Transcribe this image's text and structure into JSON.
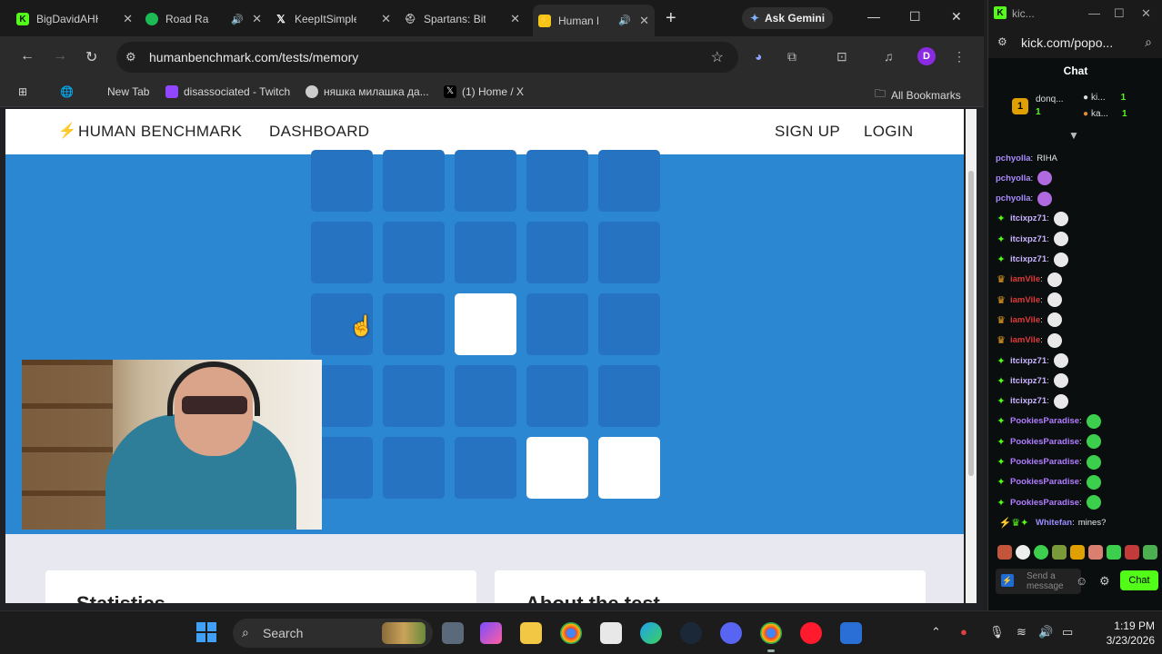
{
  "browser": {
    "tabs": [
      {
        "label": "BigDavidAHH",
        "icon": "kick-icon",
        "color": "#53fc18",
        "sound": false
      },
      {
        "label": "Road Ra",
        "icon": "spotify-icon",
        "color": "#1db954",
        "sound": true
      },
      {
        "label": "KeepItSimple",
        "icon": "x-icon",
        "color": "#ffffff",
        "sound": false
      },
      {
        "label": "Spartans: Bit",
        "icon": "spartan-icon",
        "color": "#cccccc",
        "sound": false
      },
      {
        "label": "Human B",
        "icon": "bolt-icon",
        "color": "#f5c518",
        "sound": true
      }
    ],
    "new_tab_glyph": "+",
    "gemini_label": "Ask Gemini",
    "url": "humanbenchmark.com/tests/memory",
    "profile_initial": "D",
    "bookmarks": [
      {
        "label": "New Tab",
        "color": ""
      },
      {
        "label": "disassociated - Twitch",
        "color": "#9146ff"
      },
      {
        "label": "няшка милашка да...",
        "color": "#cccccc"
      },
      {
        "label": "(1) Home / X",
        "color": "#000000"
      }
    ],
    "all_bookmarks": "All Bookmarks"
  },
  "site": {
    "brand": "HUMAN BENCHMARK",
    "dashboard": "DASHBOARD",
    "signup": "SIGN UP",
    "login": "LOGIN",
    "grid": {
      "rows": 5,
      "cols": 5,
      "lit": [
        [
          2,
          2
        ],
        [
          4,
          3
        ],
        [
          4,
          4
        ]
      ]
    },
    "cards": [
      "Statistics",
      "About the test"
    ],
    "colors": {
      "blue": "#2b87d1",
      "tile": "#2573c1",
      "lit": "#ffffff"
    }
  },
  "popup": {
    "title": "kic...",
    "url": "kick.com/popo...",
    "chat_header": "Chat",
    "gifters": [
      {
        "name": "donq...",
        "count": "1"
      },
      {
        "name": "ki...",
        "count": "1"
      },
      {
        "name": "ka...",
        "count": "1"
      }
    ],
    "messages": [
      {
        "user": "pchyolla",
        "text": "RIHA",
        "color": "#a98bff",
        "badge": "",
        "emote": ""
      },
      {
        "user": "pchyolla",
        "text": "",
        "color": "#a98bff",
        "badge": "",
        "emote": "#b06ae0"
      },
      {
        "user": "pchyolla",
        "text": "",
        "color": "#a98bff",
        "badge": "",
        "emote": "#b06ae0"
      },
      {
        "user": "itcixpz71",
        "text": "",
        "color": "#c9b3ff",
        "badge": "sub-badge",
        "emote": "#e8e8e8"
      },
      {
        "user": "itcixpz71",
        "text": "",
        "color": "#c9b3ff",
        "badge": "sub-badge",
        "emote": "#e8e8e8"
      },
      {
        "user": "itcixpz71",
        "text": "",
        "color": "#c9b3ff",
        "badge": "sub-badge",
        "emote": "#e8e8e8"
      },
      {
        "user": "iamVile",
        "text": "",
        "color": "#e03a3a",
        "badge": "crown-badge",
        "emote": "#e8e8e8"
      },
      {
        "user": "iamVile",
        "text": "",
        "color": "#e03a3a",
        "badge": "crown-badge",
        "emote": "#e8e8e8"
      },
      {
        "user": "iamVile",
        "text": "",
        "color": "#e03a3a",
        "badge": "crown-badge",
        "emote": "#e8e8e8"
      },
      {
        "user": "iamVile",
        "text": "",
        "color": "#e03a3a",
        "badge": "crown-badge",
        "emote": "#e8e8e8"
      },
      {
        "user": "itcixpz71",
        "text": "",
        "color": "#c9b3ff",
        "badge": "sub-badge",
        "emote": "#e8e8e8"
      },
      {
        "user": "itcixpz71",
        "text": "",
        "color": "#c9b3ff",
        "badge": "sub-badge",
        "emote": "#e8e8e8"
      },
      {
        "user": "itcixpz71",
        "text": "",
        "color": "#c9b3ff",
        "badge": "sub-badge",
        "emote": "#e8e8e8"
      },
      {
        "user": "PookiesParadise",
        "text": "",
        "color": "#b07cff",
        "badge": "sub-badge",
        "emote": "#3ccf4e"
      },
      {
        "user": "PookiesParadise",
        "text": "",
        "color": "#b07cff",
        "badge": "sub-badge",
        "emote": "#3ccf4e"
      },
      {
        "user": "PookiesParadise",
        "text": "",
        "color": "#b07cff",
        "badge": "sub-badge",
        "emote": "#3ccf4e"
      },
      {
        "user": "PookiesParadise",
        "text": "",
        "color": "#b07cff",
        "badge": "sub-badge",
        "emote": "#3ccf4e"
      },
      {
        "user": "PookiesParadise",
        "text": "",
        "color": "#b07cff",
        "badge": "sub-badge",
        "emote": "#3ccf4e"
      },
      {
        "user": "Whitefan",
        "text": "mines?",
        "color": "#9b8cff",
        "badge": "multi-badge",
        "emote": ""
      }
    ],
    "input_placeholder": "Send a message",
    "chat_button": "Chat",
    "accent": "#53fc18"
  },
  "taskbar": {
    "search_label": "Search",
    "time": "1:19 PM",
    "date": "3/23/2026"
  }
}
